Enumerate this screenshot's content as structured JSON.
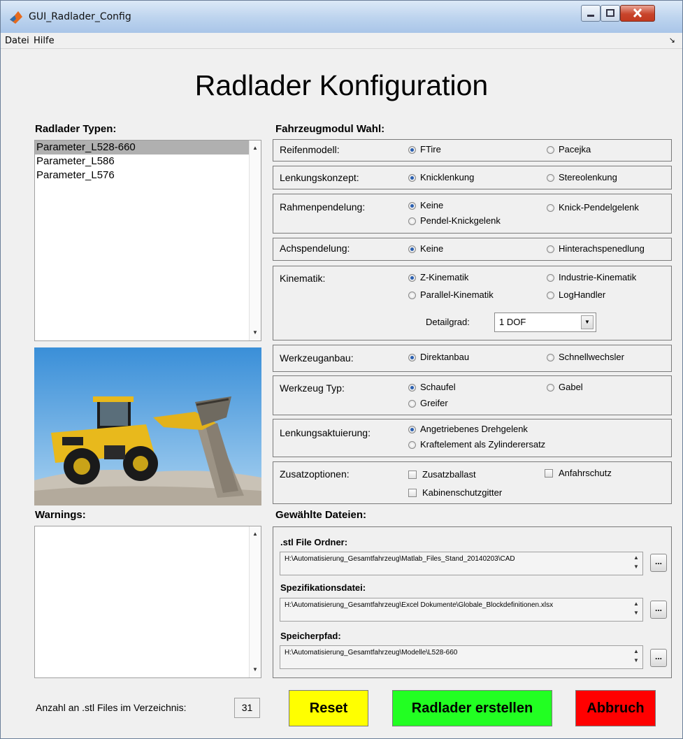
{
  "window": {
    "title": "GUI_Radlader_Config"
  },
  "menu": {
    "items": [
      "Datei",
      "Hilfe"
    ]
  },
  "header": {
    "title": "Radlader Konfiguration"
  },
  "types": {
    "label": "Radlader Typen:",
    "items": [
      "Parameter_L528-660",
      "Parameter_L586",
      "Parameter_L576"
    ],
    "selected_index": 0
  },
  "modules": {
    "label": "Fahrzeugmodul Wahl:",
    "reifenmodell": {
      "label": "Reifenmodell:",
      "opt1": "FTire",
      "opt2": "Pacejka",
      "selected": "FTire"
    },
    "lenkungskonzept": {
      "label": "Lenkungskonzept:",
      "opt1": "Knicklenkung",
      "opt2": "Stereolenkung",
      "selected": "Knicklenkung"
    },
    "rahmenpendelung": {
      "label": "Rahmenpendelung:",
      "opt1": "Keine",
      "opt2": "Knick-Pendelgelenk",
      "opt3": "Pendel-Knickgelenk",
      "selected": "Keine"
    },
    "achspendelung": {
      "label": "Achspendelung:",
      "opt1": "Keine",
      "opt2": "Hinterachspenedlung",
      "selected": "Keine"
    },
    "kinematik": {
      "label": "Kinematik:",
      "opt1": "Z-Kinematik",
      "opt2": "Industrie-Kinematik",
      "opt3": "Parallel-Kinematik",
      "opt4": "LogHandler",
      "selected": "Z-Kinematik",
      "detail_label": "Detailgrad:",
      "detail_value": "1 DOF"
    },
    "werkzeuganbau": {
      "label": "Werkzeuganbau:",
      "opt1": "Direktanbau",
      "opt2": "Schnellwechsler",
      "selected": "Direktanbau"
    },
    "werkzeugtyp": {
      "label": "Werkzeug Typ:",
      "opt1": "Schaufel",
      "opt2": "Gabel",
      "opt3": "Greifer",
      "selected": "Schaufel"
    },
    "lenkungsaktuierung": {
      "label": "Lenkungsaktuierung:",
      "opt1": "Angetriebenes Drehgelenk",
      "opt2": "Kraftelement als Zylinderersatz",
      "selected": "Angetriebenes Drehgelenk"
    },
    "zusatzoptionen": {
      "label": "Zusatzoptionen:",
      "opt1": "Zusatzballast",
      "opt2": "Anfahrschutz",
      "opt3": "Kabinenschutzgitter"
    }
  },
  "warnings": {
    "label": "Warnings:"
  },
  "files": {
    "label": "Gewählte Dateien:",
    "stl": {
      "label": ".stl File Ordner:",
      "value": "H:\\Automatisierung_Gesamtfahrzeug\\Matlab_Files_Stand_20140203\\CAD"
    },
    "spec": {
      "label": "Spezifikationsdatei:",
      "value": "H:\\Automatisierung_Gesamtfahrzeug\\Excel Dokumente\\Globale_Blockdefinitionen.xlsx"
    },
    "save": {
      "label": "Speicherpfad:",
      "value": "H:\\Automatisierung_Gesamtfahrzeug\\Modelle\\L528-660"
    },
    "browse_label": "..."
  },
  "footer": {
    "count_label": "Anzahl an .stl Files im Verzeichnis:",
    "count_value": "31",
    "reset": "Reset",
    "create": "Radlader erstellen",
    "abort": "Abbruch"
  },
  "colors": {
    "reset": "#ffff00",
    "create": "#22ff22",
    "abort": "#ff0000"
  }
}
